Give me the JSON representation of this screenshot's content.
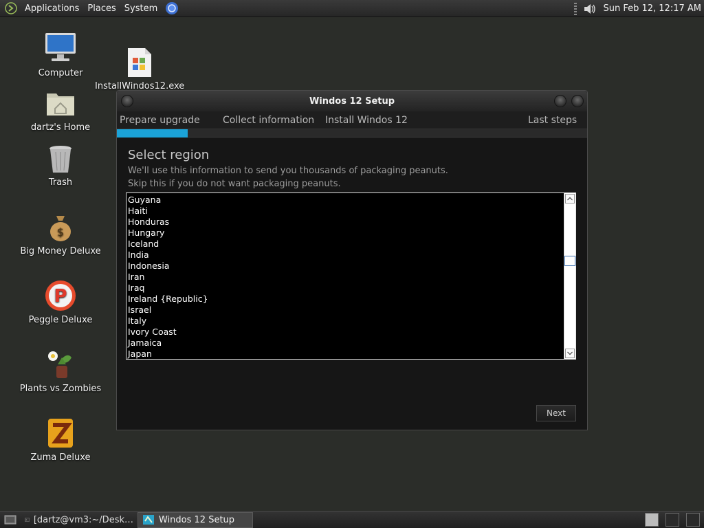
{
  "top_panel": {
    "menus": [
      "Applications",
      "Places",
      "System"
    ],
    "clock": "Sun Feb 12, 12:17 AM"
  },
  "desktop": {
    "icons": [
      {
        "label": "Computer",
        "icon": "computer-icon"
      },
      {
        "label": "dartz's Home",
        "icon": "home-folder-icon"
      },
      {
        "label": "Trash",
        "icon": "trash-icon"
      },
      {
        "label": "Big Money Deluxe",
        "icon": "money-bag-icon"
      },
      {
        "label": "Peggle Deluxe",
        "icon": "peggle-icon"
      },
      {
        "label": "Plants vs Zombies",
        "icon": "plants-vs-zombies-icon"
      },
      {
        "label": "Zuma Deluxe",
        "icon": "zuma-icon"
      },
      {
        "label": "InstallWindos12.exe",
        "icon": "exe-file-icon"
      }
    ]
  },
  "window": {
    "title": "Windos 12 Setup",
    "steps": [
      "Prepare upgrade",
      "Collect information",
      "Install Windos 12",
      "Last steps"
    ],
    "progress_fraction": 0.15,
    "heading": "Select region",
    "description_line1": "We'll use this information to send you thousands of packaging peanuts.",
    "description_line2": "Skip this if you do not want packaging peanuts.",
    "regions": [
      "Guyana",
      "Haiti",
      "Honduras",
      "Hungary",
      "Iceland",
      "India",
      "Indonesia",
      "Iran",
      "Iraq",
      "Ireland {Republic}",
      "Israel",
      "Italy",
      "Ivory Coast",
      "Jamaica",
      "Japan"
    ],
    "next_label": "Next"
  },
  "taskbar": {
    "tasks": [
      "[dartz@vm3:~/Desk…",
      "Windos 12 Setup"
    ]
  },
  "colors": {
    "accent": "#1ba3d8",
    "desktop_bg": "#2b2d29"
  }
}
